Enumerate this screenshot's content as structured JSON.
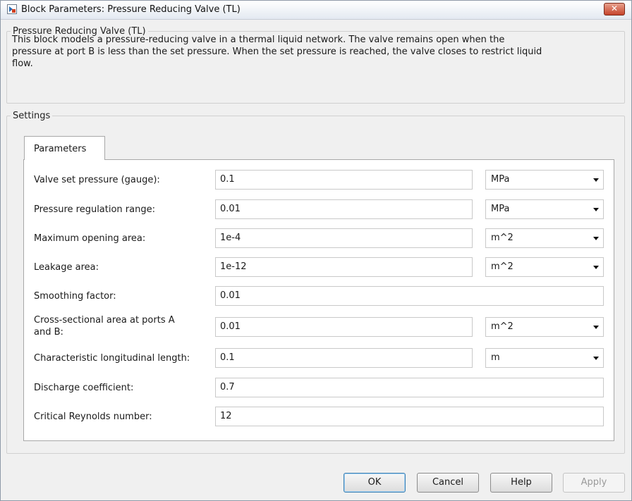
{
  "window": {
    "title": "Block Parameters: Pressure Reducing Valve (TL)",
    "close_label": "✕"
  },
  "description": {
    "group_title": "Pressure Reducing Valve (TL)",
    "lines": [
      "This block models a pressure-reducing valve in a thermal liquid network. The valve remains open when the",
      "pressure at port B is less than the set pressure. When the set pressure is reached, the valve closes to restrict liquid",
      "flow."
    ]
  },
  "settings": {
    "group_title": "Settings",
    "tab_label": "Parameters",
    "params": [
      {
        "label_lines": [
          "Valve set pressure (gauge):"
        ],
        "value": "0.1",
        "unit": "MPa"
      },
      {
        "label_lines": [
          "Pressure regulation range:"
        ],
        "value": "0.01",
        "unit": "MPa"
      },
      {
        "label_lines": [
          "Maximum opening area:"
        ],
        "value": "1e-4",
        "unit": "m^2"
      },
      {
        "label_lines": [
          "Leakage area:"
        ],
        "value": "1e-12",
        "unit": "m^2"
      },
      {
        "label_lines": [
          "Smoothing factor:"
        ],
        "value": "0.01",
        "unit": ""
      },
      {
        "label_lines": [
          "Cross-sectional area at ports A",
          "and B:"
        ],
        "value": "0.01",
        "unit": "m^2"
      },
      {
        "label_lines": [
          "Characteristic longitudinal length:"
        ],
        "value": "0.1",
        "unit": "m"
      },
      {
        "label_lines": [
          "Discharge coefficient:"
        ],
        "value": "0.7",
        "unit": ""
      },
      {
        "label_lines": [
          "Critical Reynolds number:"
        ],
        "value": "12",
        "unit": ""
      }
    ]
  },
  "buttons": {
    "ok": "OK",
    "cancel": "Cancel",
    "help": "Help",
    "apply": "Apply"
  }
}
